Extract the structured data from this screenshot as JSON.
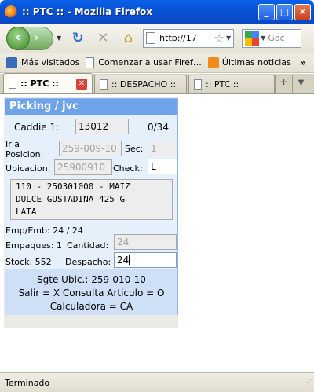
{
  "window": {
    "title": ":: PTC :: - Mozilla Firefox",
    "minimize_glyph": "_",
    "maximize_glyph": "□",
    "close_glyph": "✕"
  },
  "nav": {
    "url": "http://17",
    "search_placeholder": "Goc"
  },
  "bookmarks": {
    "items": [
      "Más visitados",
      "Comenzar a usar Firef…",
      "Últimas noticias"
    ],
    "overflow": "»"
  },
  "tabs": [
    {
      "label": ":: PTC ::",
      "active": true
    },
    {
      "label": ":: DESPACHO ::",
      "active": false
    },
    {
      "label": ":: PTC ::",
      "active": false
    }
  ],
  "app": {
    "title": "Picking / jvc",
    "caddie_label": "Caddie 1:",
    "caddie_value": "13012",
    "counter": "0/34",
    "ir_label_1": "Ir a",
    "ir_label_2": "Posicion:",
    "posicion_value": "259-009-10",
    "sec_label": "Sec:",
    "sec_value": "1",
    "ubicacion_label": "Ubicacion:",
    "ubicacion_value": "25900910",
    "check_label": "Check:",
    "check_value": "L",
    "description": "110 - 250301000 - MAIZ\nDULCE GUSTADINA 425 G\nLATA",
    "emp_line": "Emp/Emb: 24 / 24",
    "empaques_label": "Empaques: 1",
    "cantidad_label": "Cantidad:",
    "cantidad_value": "24",
    "stock_label": "Stock: 552",
    "despacho_label": "Despacho:",
    "despacho_value": "24",
    "sgte_ubic": "Sgte Ubic.: 259-010-10",
    "help_line_1": "Salir = X Consulta Articulo = O",
    "help_line_2": "Calculadora = CA"
  },
  "status": {
    "text": "Terminado"
  },
  "colors": {
    "titlebar": "#0754d6",
    "app_header": "#6fa3e9",
    "app_background": "#e6f0fb",
    "bottom_band": "#cfe0f6"
  }
}
